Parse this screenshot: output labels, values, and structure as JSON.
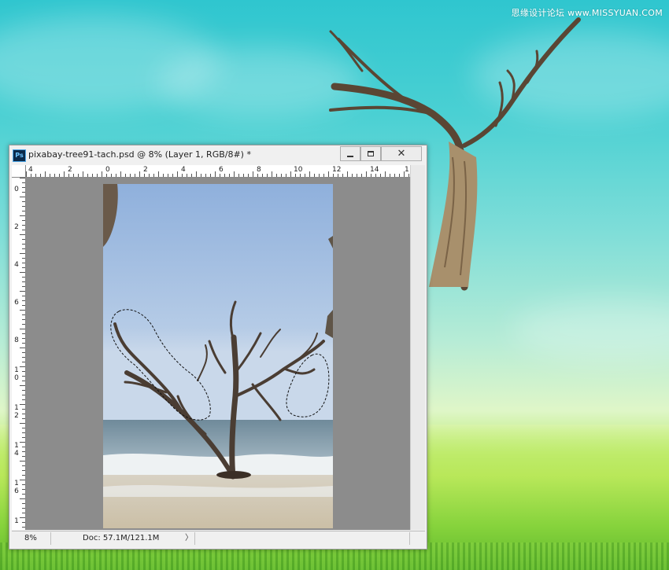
{
  "watermark": "思缘设计论坛 www.MISSYUAN.COM",
  "window": {
    "title": "pixabay-tree91-tach.psd @ 8% (Layer 1, RGB/8#) *",
    "app_icon_label": "Ps",
    "controls": {
      "minimize": "minimize-icon",
      "maximize": "maximize-icon",
      "close": "close-icon",
      "close_glyph": "✕"
    }
  },
  "ruler": {
    "horizontal_labels": [
      "4",
      "2",
      "0",
      "2",
      "4",
      "6",
      "8",
      "10",
      "12",
      "14",
      "1"
    ],
    "vertical_labels": [
      "0",
      "2",
      "4",
      "6",
      "8",
      "10",
      "12",
      "14",
      "16",
      "1"
    ]
  },
  "statusbar": {
    "zoom": "8%",
    "doc": "Doc: 57.1M/121.1M",
    "arrow": "〉"
  },
  "colors": {
    "sky_top": "#2fc6cf",
    "grass": "#86d33c",
    "canvas_bg": "#8c8c8c",
    "window_chrome": "#f0f0f0"
  }
}
